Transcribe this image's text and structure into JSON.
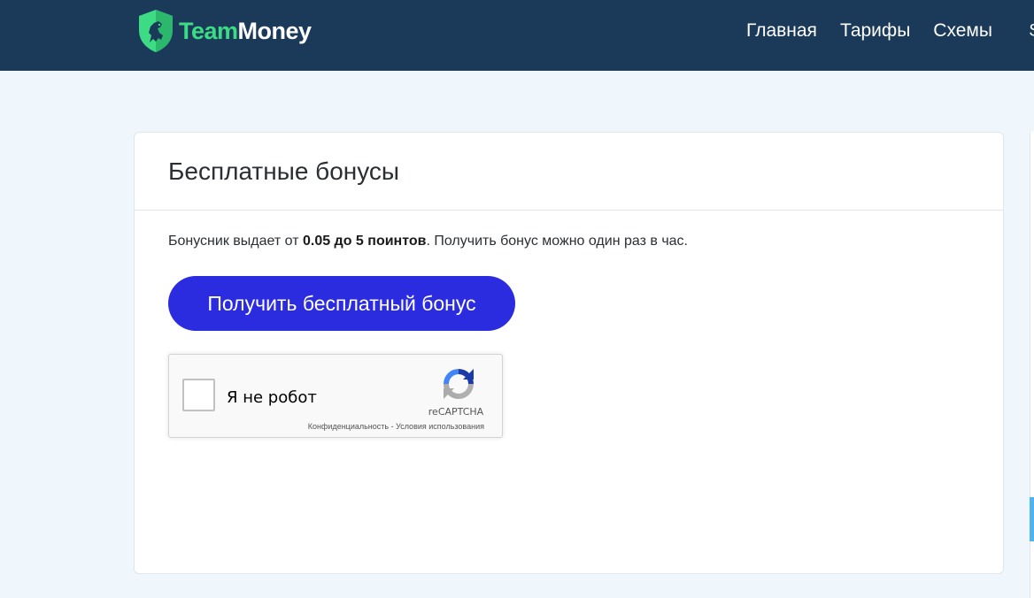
{
  "header": {
    "logo": {
      "part1": "Team",
      "part2": "Money"
    },
    "nav": [
      {
        "label": "Главная"
      },
      {
        "label": "Тарифы"
      },
      {
        "label": "Схемы"
      }
    ],
    "nav_clipped": "$"
  },
  "card": {
    "title": "Бесплатные бонусы",
    "info": {
      "prefix": "Бонусник выдает от ",
      "bold": "0.05 до 5 поинтов",
      "suffix": ". Получить бонус можно один раз в час."
    },
    "button_label": "Получить бесплатный бонус"
  },
  "recaptcha": {
    "label": "Я не робот",
    "brand": "reCAPTCHA",
    "privacy": "Конфиденциальность",
    "separator": " - ",
    "terms": "Условия использования",
    "checked": false
  },
  "colors": {
    "navbar": "#1b3a5a",
    "logo_team": "#3ddc84",
    "button": "#2b2be0",
    "page_bg": "#eff6fc"
  },
  "icons": {
    "logo": "shield-lion-icon",
    "recaptcha": "recaptcha-icon"
  }
}
